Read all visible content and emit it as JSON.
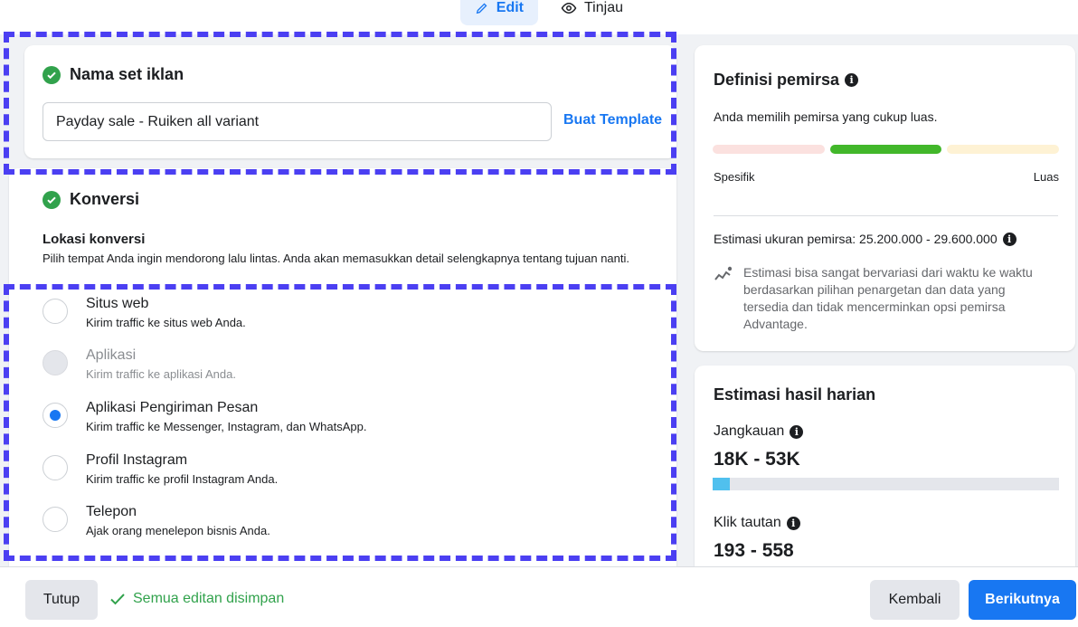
{
  "tabs": {
    "edit": "Edit",
    "view": "Tinjau"
  },
  "adset_name": {
    "title": "Nama set iklan",
    "input_value": "Payday sale - Ruiken all variant",
    "template_link": "Buat Template"
  },
  "conversion": {
    "title": "Konversi",
    "location_heading": "Lokasi konversi",
    "location_desc": "Pilih tempat Anda ingin mendorong lalu lintas. Anda akan memasukkan detail selengkapnya tentang tujuan nanti.",
    "options": [
      {
        "label": "Situs web",
        "sub": "Kirim traffic ke situs web Anda.",
        "state": "unchecked"
      },
      {
        "label": "Aplikasi",
        "sub": "Kirim traffic ke aplikasi Anda.",
        "state": "disabled"
      },
      {
        "label": "Aplikasi Pengiriman Pesan",
        "sub": "Kirim traffic ke Messenger, Instagram, dan WhatsApp.",
        "state": "checked"
      },
      {
        "label": "Profil Instagram",
        "sub": "Kirim traffic ke profil Instagram Anda.",
        "state": "unchecked"
      },
      {
        "label": "Telepon",
        "sub": "Ajak orang menelepon bisnis Anda.",
        "state": "unchecked"
      }
    ]
  },
  "audience_definition": {
    "title": "Definisi pemirsa",
    "summary": "Anda memilih pemirsa yang cukup luas.",
    "meter_left": "Spesifik",
    "meter_right": "Luas",
    "estimate": "Estimasi ukuran pemirsa: 25.200.000 - 29.600.000",
    "note": "Estimasi bisa sangat bervariasi dari waktu ke waktu berdasarkan pilihan penargetan dan data yang tersedia dan tidak mencerminkan opsi pemirsa Advantage."
  },
  "daily_results": {
    "title": "Estimasi hasil harian",
    "reach_label": "Jangkauan",
    "reach_value": "18K - 53K",
    "reach_fraction": 0.05,
    "clicks_label": "Klik tautan",
    "clicks_value": "193 - 558"
  },
  "footer": {
    "close": "Tutup",
    "saved": "Semua editan disimpan",
    "back": "Kembali",
    "next": "Berikutnya"
  },
  "colors": {
    "primary": "#1877f2",
    "success": "#31a24c",
    "highlight_dash": "#4b3ff2",
    "meter_selected": "#42b72a",
    "reach_bar": "#50c0ee"
  }
}
